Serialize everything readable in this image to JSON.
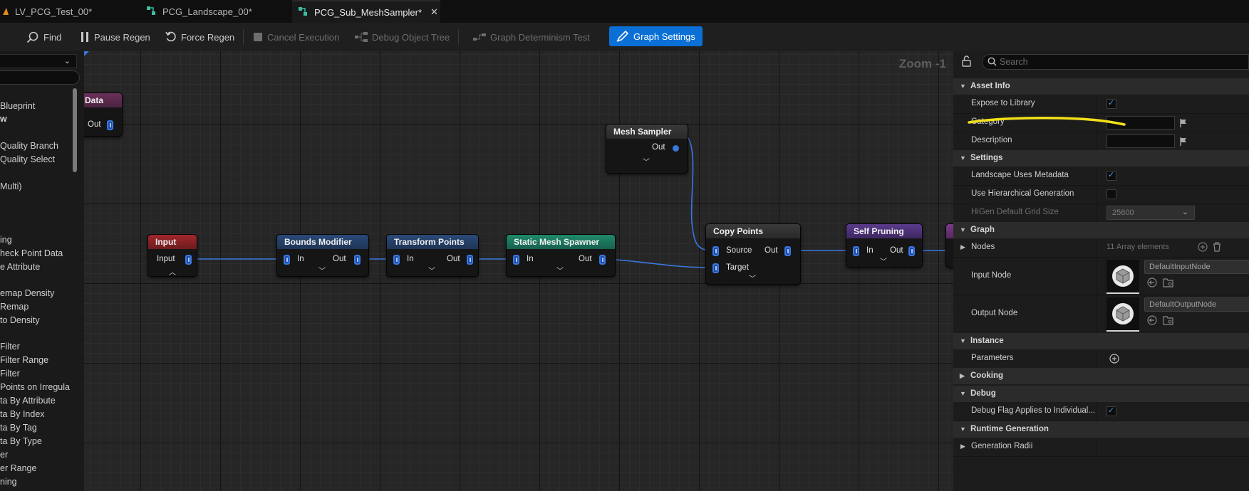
{
  "tabs": [
    {
      "label": "LV_PCG_Test_00*"
    },
    {
      "label": "PCG_Landscape_00*"
    },
    {
      "label": "PCG_Sub_MeshSampler*"
    }
  ],
  "toolbar": {
    "find": "Find",
    "pause_regen": "Pause Regen",
    "force_regen": "Force Regen",
    "cancel_execution": "Cancel Execution",
    "debug_object_tree": "Debug Object Tree",
    "graph_determinism_test": "Graph Determinism Test",
    "graph_settings": "Graph Settings"
  },
  "palette": {
    "items": [
      "Blueprint",
      "w",
      "Quality Branch",
      "Quality Select",
      "Multi)",
      "ing",
      "heck Point Data",
      "e Attribute",
      "emap Density",
      "Remap",
      "to Density",
      "Filter",
      "Filter Range",
      "Filter",
      "Points on Irregula",
      "ta By Attribute",
      "ta By Index",
      "ta By Tag",
      "ta By Type",
      "er",
      "er Range",
      "ning"
    ]
  },
  "graph": {
    "zoom": "Zoom -1",
    "nodes": {
      "data": {
        "title": "Data",
        "out": "Out"
      },
      "input": {
        "title": "Input",
        "pin": "Input"
      },
      "bounds": {
        "title": "Bounds Modifier",
        "in": "In",
        "out": "Out"
      },
      "transform": {
        "title": "Transform Points",
        "in": "In",
        "out": "Out"
      },
      "spawner": {
        "title": "Static Mesh Spawner",
        "in": "In",
        "out": "Out"
      },
      "mesh_sampler": {
        "title": "Mesh Sampler",
        "out": "Out"
      },
      "copy_points": {
        "title": "Copy Points",
        "source": "Source",
        "target": "Target",
        "out": "Out"
      },
      "self_pruning": {
        "title": "Self Pruning",
        "in": "In",
        "out": "Out"
      }
    }
  },
  "details": {
    "search_placeholder": "Search",
    "sections": {
      "asset_info": "Asset Info",
      "settings": "Settings",
      "graph": "Graph",
      "instance": "Instance",
      "cooking": "Cooking",
      "debug": "Debug",
      "runtime": "Runtime Generation"
    },
    "props": {
      "expose": "Expose to Library",
      "category": "Category",
      "description": "Description",
      "landscape_metadata": "Landscape Uses Metadata",
      "hierarchical": "Use Hierarchical Generation",
      "higen_grid": "HiGen Default Grid Size",
      "higen_value": "25600",
      "nodes": "Nodes",
      "nodes_value": "11 Array elements",
      "input_node": "Input Node",
      "input_node_value": "DefaultInputNode",
      "output_node": "Output Node",
      "output_node_value": "DefaultOutputNode",
      "parameters": "Parameters",
      "debug_flag": "Debug Flag Applies to Individual...",
      "generation_radii": "Generation Radii"
    }
  },
  "colors": {
    "accent": "#0a70d6",
    "pin": "#3a78e0",
    "annotation": "#f2e01a"
  }
}
